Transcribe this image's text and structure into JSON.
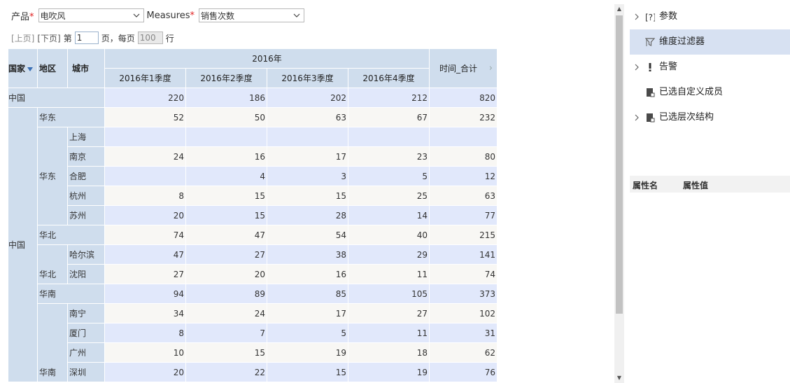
{
  "toolbar": {
    "product_label": "产品",
    "product_value": "电吹风",
    "measures_label": "Measures",
    "measures_value": "销售次数",
    "required_mark": "*",
    "prev_page": "[上页]",
    "next_page": "[下页]",
    "page_prefix": "第",
    "page_value": "1",
    "page_suffix": "页，每页",
    "rows_value": "100",
    "rows_suffix": "行"
  },
  "table": {
    "header": {
      "country": "国家",
      "region": "地区",
      "city": "城市",
      "year": "2016年",
      "quarters": [
        "2016年1季度",
        "2016年2季度",
        "2016年3季度",
        "2016年4季度"
      ],
      "total": "时间_合计"
    },
    "rows": [
      {
        "country": "中国",
        "region": "",
        "city": "",
        "values": [
          "220",
          "186",
          "202",
          "212",
          "820"
        ]
      },
      {
        "country": "",
        "region": "华东",
        "city": "",
        "values": [
          "52",
          "50",
          "63",
          "67",
          "232"
        ]
      },
      {
        "country": "",
        "region": "",
        "city": "上海",
        "values": [
          "",
          "",
          "",
          "",
          ""
        ]
      },
      {
        "country": "",
        "region": "",
        "city": "南京",
        "values": [
          "24",
          "16",
          "17",
          "23",
          "80"
        ]
      },
      {
        "country": "",
        "region": "华东",
        "city": "合肥",
        "values": [
          "",
          "4",
          "3",
          "5",
          "12"
        ]
      },
      {
        "country": "",
        "region": "",
        "city": "杭州",
        "values": [
          "8",
          "15",
          "15",
          "25",
          "63"
        ]
      },
      {
        "country": "",
        "region": "",
        "city": "苏州",
        "values": [
          "20",
          "15",
          "28",
          "14",
          "77"
        ]
      },
      {
        "country": "",
        "region": "华北",
        "city": "",
        "values": [
          "74",
          "47",
          "54",
          "40",
          "215"
        ]
      },
      {
        "country": "",
        "region": "",
        "city": "哈尔滨",
        "values": [
          "47",
          "27",
          "38",
          "29",
          "141"
        ]
      },
      {
        "country": "中国",
        "region": "华北",
        "city": "沈阳",
        "values": [
          "27",
          "20",
          "16",
          "11",
          "74"
        ]
      },
      {
        "country": "",
        "region": "华南",
        "city": "",
        "values": [
          "94",
          "89",
          "85",
          "105",
          "373"
        ]
      },
      {
        "country": "",
        "region": "",
        "city": "南宁",
        "values": [
          "34",
          "24",
          "17",
          "27",
          "102"
        ]
      },
      {
        "country": "",
        "region": "",
        "city": "厦门",
        "values": [
          "8",
          "7",
          "5",
          "11",
          "31"
        ]
      },
      {
        "country": "",
        "region": "",
        "city": "广州",
        "values": [
          "10",
          "15",
          "19",
          "18",
          "62"
        ]
      },
      {
        "country": "",
        "region": "华南",
        "city": "深圳",
        "values": [
          "20",
          "22",
          "15",
          "19",
          "76"
        ]
      }
    ]
  },
  "panel": {
    "items": [
      {
        "label": "参数",
        "icon": "bracket-question-icon",
        "selected": false,
        "expandable": true
      },
      {
        "label": "维度过滤器",
        "icon": "filter-icon",
        "selected": true,
        "expandable": false
      },
      {
        "label": "告警",
        "icon": "exclamation-icon",
        "selected": false,
        "expandable": true
      },
      {
        "label": "已选自定义成员",
        "icon": "member-icon",
        "selected": false,
        "expandable": false
      },
      {
        "label": "已选层次结构",
        "icon": "hierarchy-icon",
        "selected": false,
        "expandable": true
      }
    ],
    "prop_name": "属性名",
    "prop_value": "属性值"
  },
  "colors": {
    "header_bg": "#cfdded",
    "stripe_a": "#e1e8fb",
    "stripe_b": "#f8f7f4",
    "selected_bg": "#d7e1f2",
    "required": "#e02020"
  }
}
